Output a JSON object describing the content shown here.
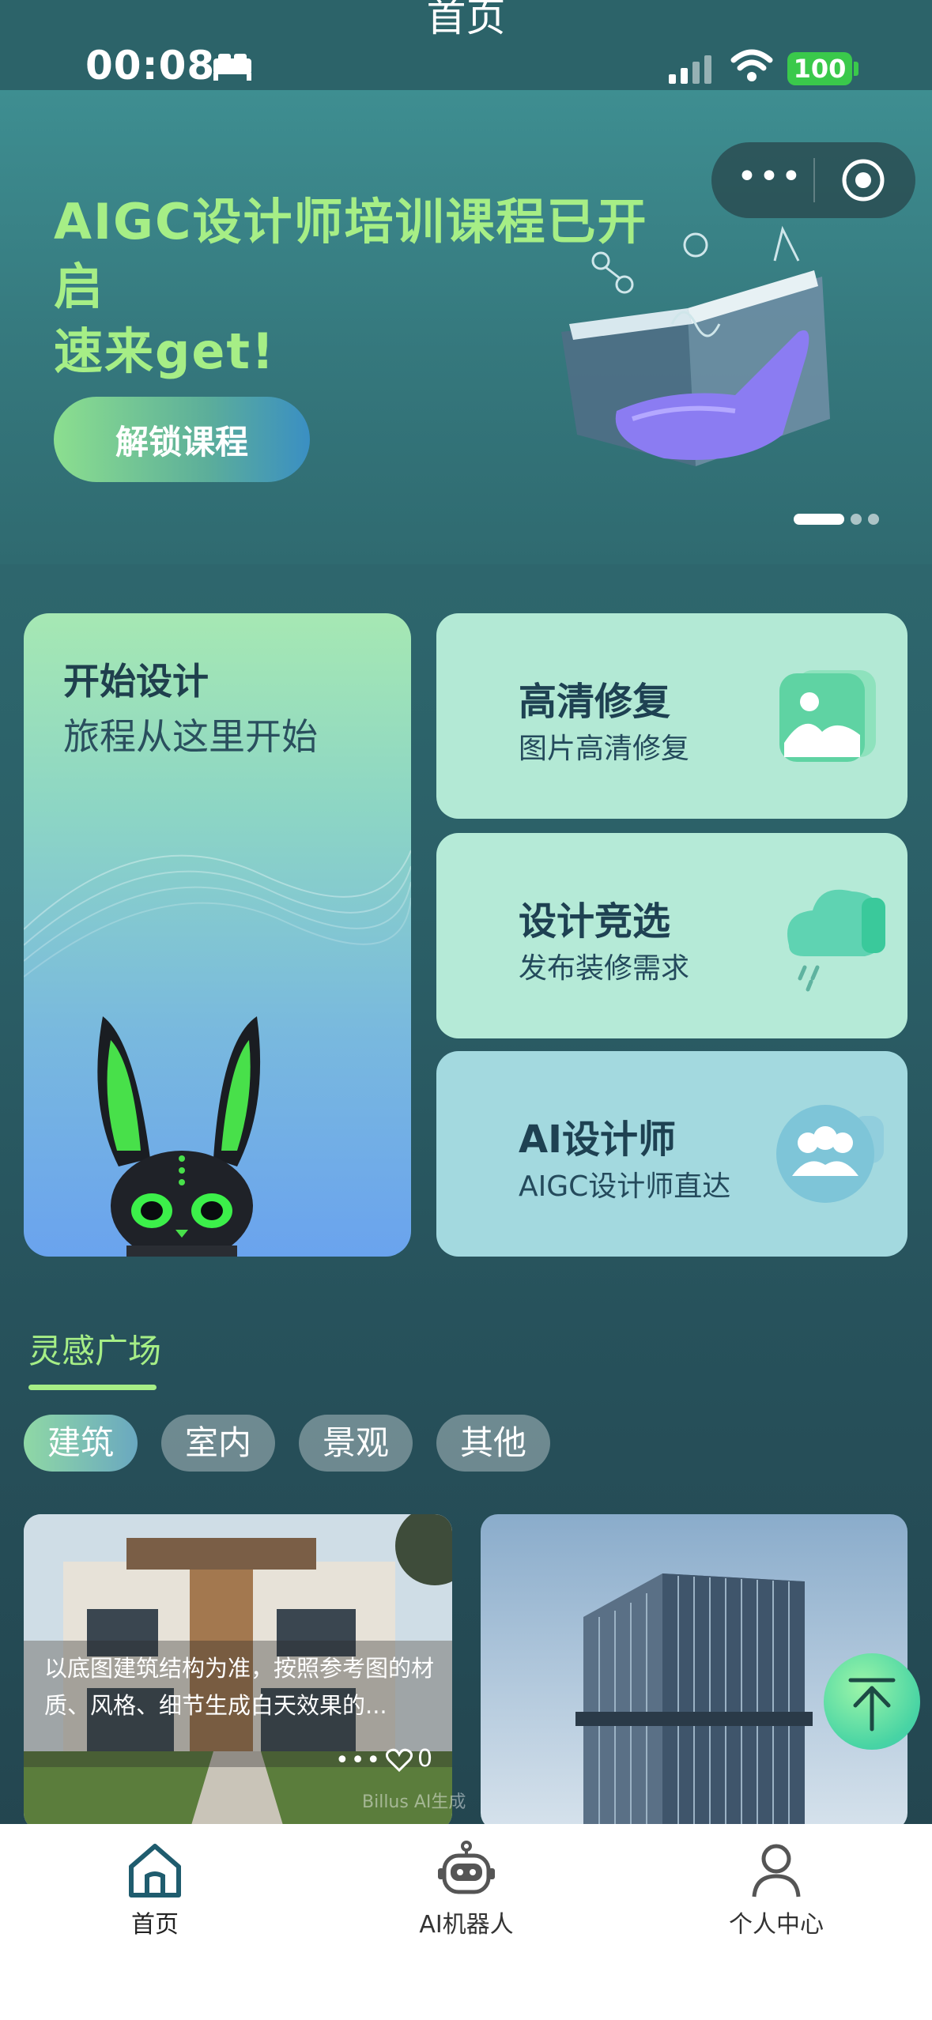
{
  "nav": {
    "title": "首页"
  },
  "status_bar": {
    "time": "00:08",
    "battery": "100"
  },
  "banner": {
    "title_line1": "AIGC设计师培训课程已开启",
    "title_line2": "速来get!",
    "button": "解锁课程"
  },
  "features": {
    "start": {
      "title": "开始设计",
      "subtitle": "旅程从这里开始"
    },
    "items": [
      {
        "title": "高清修复",
        "subtitle": "图片高清修复",
        "icon": "image-icon"
      },
      {
        "title": "设计竞选",
        "subtitle": "发布装修需求",
        "icon": "cloud-icon"
      },
      {
        "title": "AI设计师",
        "subtitle": "AIGC设计师直达",
        "icon": "users-icon"
      }
    ]
  },
  "inspiration": {
    "title": "灵感广场",
    "categories": [
      "建筑",
      "室内",
      "景观",
      "其他"
    ],
    "selected_category": "建筑",
    "cards": [
      {
        "caption": "以底图建筑结构为准，按照参考图的材质、风格、细节生成白天效果的...",
        "likes": "0",
        "watermark": "Billus AI生成"
      }
    ]
  },
  "tabbar": {
    "items": [
      {
        "label": "首页",
        "icon": "home-icon"
      },
      {
        "label": "AI机器人",
        "icon": "robot-icon"
      },
      {
        "label": "个人中心",
        "icon": "user-icon"
      }
    ]
  },
  "colors": {
    "accent_green": "#a6ee86",
    "tabbar_bg": "#ffffff"
  }
}
